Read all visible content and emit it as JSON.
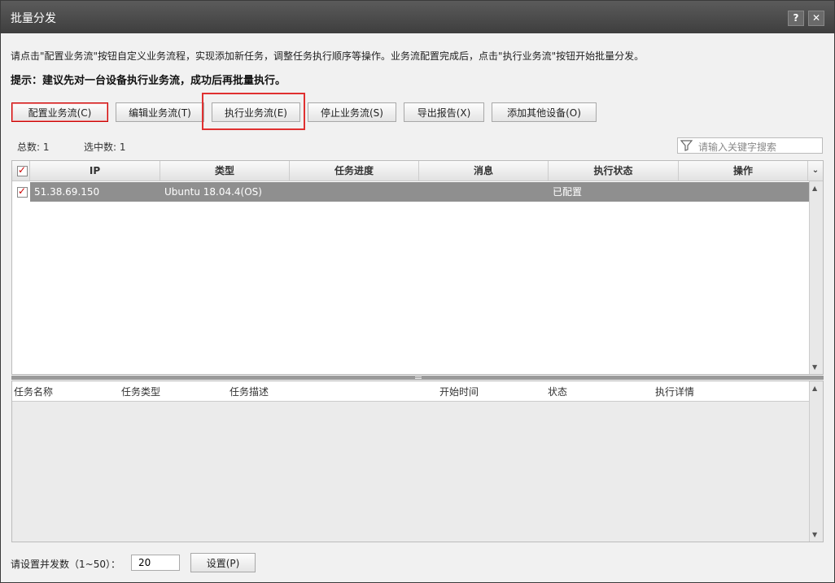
{
  "window": {
    "title": "批量分发",
    "help_label": "?",
    "close_label": "✕"
  },
  "description": "请点击\"配置业务流\"按钮自定义业务流程，实现添加新任务，调整任务执行顺序等操作。业务流配置完成后，点击\"执行业务流\"按钮开始批量分发。",
  "hint": "提示：建议先对一台设备执行业务流，成功后再批量执行。",
  "toolbar": {
    "configure": "配置业务流(C)",
    "edit": "编辑业务流(T)",
    "execute": "执行业务流(E)",
    "stop": "停止业务流(S)",
    "export": "导出报告(X)",
    "add_device": "添加其他设备(O)"
  },
  "stats": {
    "total": "总数: 1",
    "selected": "选中数: 1"
  },
  "search": {
    "placeholder": "请输入关键字搜索",
    "icon": "filter-icon"
  },
  "device_table": {
    "columns": [
      "IP",
      "类型",
      "任务进度",
      "消息",
      "执行状态",
      "操作"
    ],
    "rows": [
      {
        "checked": true,
        "ip": "51.38.69.150",
        "type": "Ubuntu 18.04.4(OS)",
        "progress": "",
        "message": "",
        "status": "已配置",
        "action": ""
      }
    ]
  },
  "task_table": {
    "columns": [
      "任务名称",
      "任务类型",
      "任务描述",
      "开始时间",
      "状态",
      "执行详情"
    ]
  },
  "footer": {
    "concurrency_label": "请设置并发数（1~50）：",
    "concurrency_value": "20",
    "set_button": "设置(P)"
  }
}
